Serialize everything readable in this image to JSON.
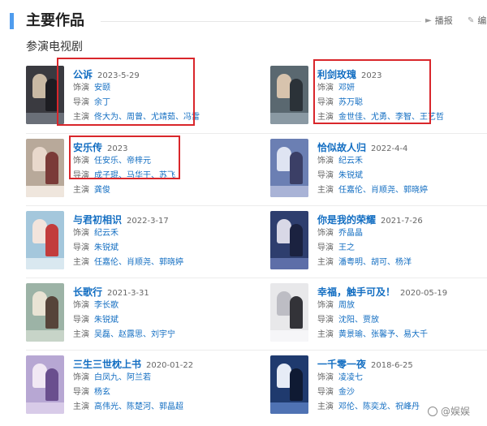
{
  "section": {
    "title": "主要作品",
    "actions": {
      "play": "播报",
      "edit": "编"
    }
  },
  "subsection": {
    "title": "参演电视剧"
  },
  "dramas": [
    {
      "title": "公诉",
      "date": "2023-5-29",
      "role_label": "饰演",
      "role": "安颐",
      "director_label": "导演",
      "directors": [
        "余丁"
      ],
      "cast_label": "主演",
      "cast": [
        "佟大为",
        "周曾",
        "尤靖茹",
        "冯雷"
      ],
      "poster_colors": [
        "#3a3a40",
        "#c9b9a4",
        "#1d1d22",
        "#6a6f78"
      ]
    },
    {
      "title": "利剑玫瑰",
      "date": "2023",
      "role_label": "饰演",
      "role": "邓妍",
      "director_label": "导演",
      "directors": [
        "苏万聪"
      ],
      "cast_label": "主演",
      "cast": [
        "金世佳",
        "尤勇",
        "李智",
        "王艺哲"
      ],
      "poster_colors": [
        "#5a6870",
        "#d7c3ad",
        "#2b3238",
        "#8a99a3"
      ]
    },
    {
      "title": "安乐传",
      "date": "2023",
      "role_label": "饰演",
      "role": "任安乐、帝梓元",
      "director_label": "导演",
      "directors": [
        "成子琨",
        "马华干",
        "苏飞"
      ],
      "cast_label": "主演",
      "cast": [
        "龚俊"
      ],
      "poster_colors": [
        "#b8a99a",
        "#e8d8cc",
        "#7a3b38",
        "#efe6dd"
      ]
    },
    {
      "title": "恰似故人归",
      "date": "2022-4-4",
      "role_label": "饰演",
      "role": "纪云禾",
      "director_label": "导演",
      "directors": [
        "朱锐斌"
      ],
      "cast_label": "主演",
      "cast": [
        "任嘉伦",
        "肖顺尧",
        "郭晓婷"
      ],
      "poster_colors": [
        "#6b7fb3",
        "#dfe4f2",
        "#3b3f66",
        "#a9b3d6"
      ]
    },
    {
      "title": "与君初相识",
      "date": "2022-3-17",
      "role_label": "饰演",
      "role": "纪云禾",
      "director_label": "导演",
      "directors": [
        "朱锐斌"
      ],
      "cast_label": "主演",
      "cast": [
        "任嘉伦",
        "肖顺尧",
        "郭晓婷"
      ],
      "poster_colors": [
        "#a4c7dc",
        "#f2e4dc",
        "#c23c3c",
        "#d9e8f0"
      ]
    },
    {
      "title": "你是我的荣耀",
      "date": "2021-7-26",
      "role_label": "饰演",
      "role": "乔晶晶",
      "director_label": "导演",
      "directors": [
        "王之"
      ],
      "cast_label": "主演",
      "cast": [
        "潘粤明",
        "胡可",
        "杨洋"
      ],
      "poster_colors": [
        "#2e3e6e",
        "#d8d8e6",
        "#1b2240",
        "#5d6ea8"
      ]
    },
    {
      "title": "长歌行",
      "date": "2021-3-31",
      "role_label": "饰演",
      "role": "李长歌",
      "director_label": "导演",
      "directors": [
        "朱锐斌"
      ],
      "cast_label": "主演",
      "cast": [
        "吴磊",
        "赵露思",
        "刘宇宁"
      ],
      "poster_colors": [
        "#9cb3a6",
        "#e9e3d4",
        "#56443a",
        "#c7d4c8"
      ]
    },
    {
      "title": "幸福，触手可及！",
      "date": "2020-05-19",
      "role_label": "饰演",
      "role": "周放",
      "director_label": "导演",
      "directors": [
        "沈阳",
        "贾放"
      ],
      "cast_label": "主演",
      "cast": [
        "黄景瑜",
        "张馨予",
        "易大千"
      ],
      "poster_colors": [
        "#e8e8ea",
        "#bdbdc4",
        "#333338",
        "#f6f6f8"
      ]
    },
    {
      "title": "三生三世枕上书",
      "date": "2020-01-22",
      "role_label": "饰演",
      "role": "白凤九、阿兰若",
      "director_label": "导演",
      "directors": [
        "杨玄"
      ],
      "cast_label": "主演",
      "cast": [
        "高伟光",
        "陈楚河",
        "郭晶超"
      ],
      "poster_colors": [
        "#b7a7d3",
        "#f1e8f4",
        "#6a4f8e",
        "#d8cbe8"
      ]
    },
    {
      "title": "一千零一夜",
      "date": "2018-6-25",
      "role_label": "饰演",
      "role": "凌凌七",
      "director_label": "导演",
      "directors": [
        "金沙"
      ],
      "cast_label": "主演",
      "cast": [
        "邓伦",
        "陈奕龙",
        "祝峰丹"
      ],
      "poster_colors": [
        "#1f3a6e",
        "#e6ecf6",
        "#0f1a33",
        "#4f72b3"
      ]
    }
  ],
  "highlight_color": "#d9262b",
  "watermark": {
    "text": "@娱娱"
  }
}
